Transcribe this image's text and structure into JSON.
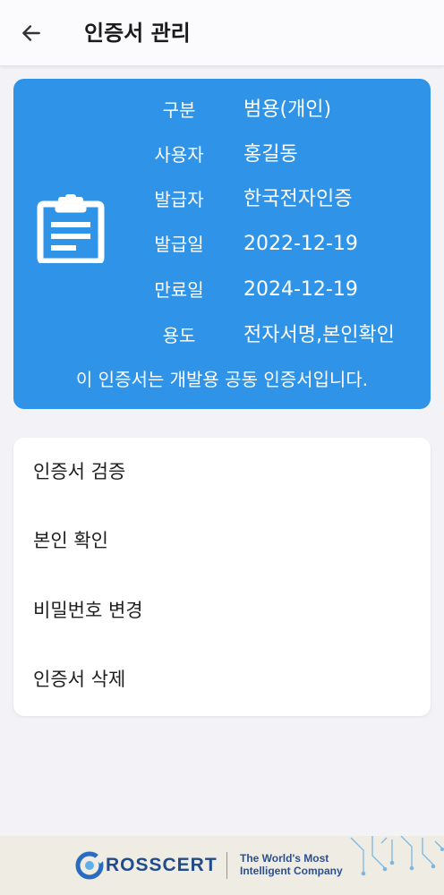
{
  "header": {
    "title": "인증서 관리",
    "back_icon": "arrow-left-icon"
  },
  "certificate": {
    "icon": "clipboard-icon",
    "fields": [
      {
        "label": "구분",
        "value": "범용(개인)"
      },
      {
        "label": "사용자",
        "value": "홍길동"
      },
      {
        "label": "발급자",
        "value": "한국전자인증"
      },
      {
        "label": "발급일",
        "value": "2022-12-19"
      },
      {
        "label": "만료일",
        "value": "2024-12-19"
      },
      {
        "label": "용도",
        "value": "전자서명,본인확인"
      }
    ],
    "notice": "이 인증서는 개발용 공동 인증서입니다."
  },
  "menu": {
    "items": [
      {
        "label": "인증서 검증"
      },
      {
        "label": "본인 확인"
      },
      {
        "label": "비밀번호 변경"
      },
      {
        "label": "인증서 삭제"
      }
    ]
  },
  "footer": {
    "brand": "ROSSCERT",
    "tagline_line1": "The World's Most",
    "tagline_line2": "Intelligent Company"
  },
  "colors": {
    "accent": "#2f93e8",
    "background": "#f3f2f6",
    "brand": "#214b8c"
  }
}
